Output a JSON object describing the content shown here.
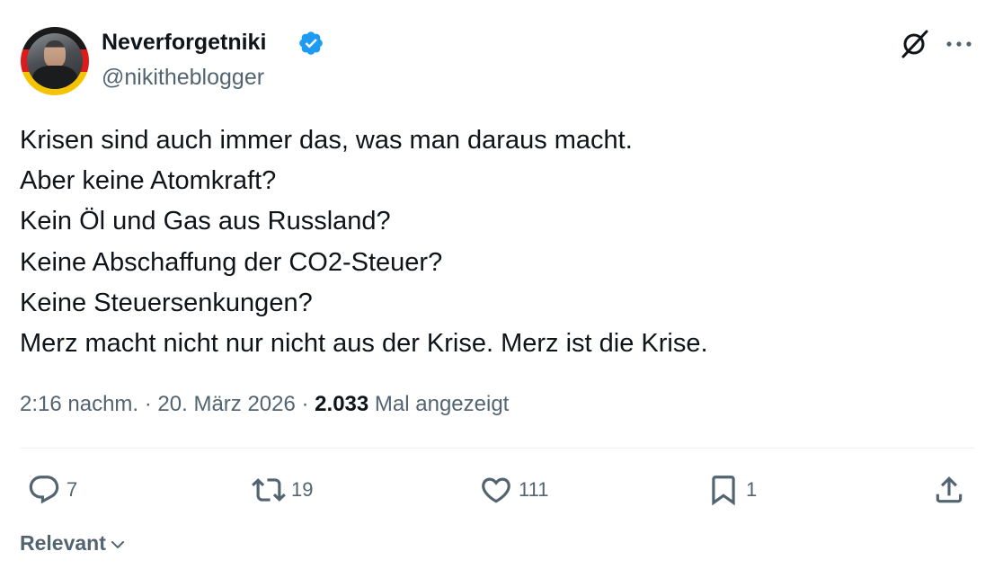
{
  "author": {
    "display_name": "Neverforgetniki",
    "handle": "@nikitheblogger",
    "verified": true,
    "avatar_icon": "avatar-with-german-flag-ring"
  },
  "post": {
    "lines": [
      "Krisen sind auch immer das, was man daraus macht.",
      "Aber keine Atomkraft?",
      "Kein Öl und Gas aus Russland?",
      "Keine Abschaffung der CO2-Steuer?",
      "Keine Steuersenkungen?",
      "Merz macht nicht nur nicht aus der Krise. Merz ist die Krise."
    ]
  },
  "meta": {
    "time": "2:16 nachm.",
    "separator": " · ",
    "date": "20. März 2026",
    "separator2": " · ",
    "views_count": "2.033",
    "views_label": " Mal angezeigt"
  },
  "actions": {
    "reply_count": "7",
    "retweet_count": "19",
    "like_count": "111",
    "bookmark_count": "1"
  },
  "sort": {
    "label": "Relevant"
  },
  "colors": {
    "text": "#0f1419",
    "secondary": "#536471",
    "verified_blue": "#1d9bf0",
    "divider": "#eff3f4"
  }
}
